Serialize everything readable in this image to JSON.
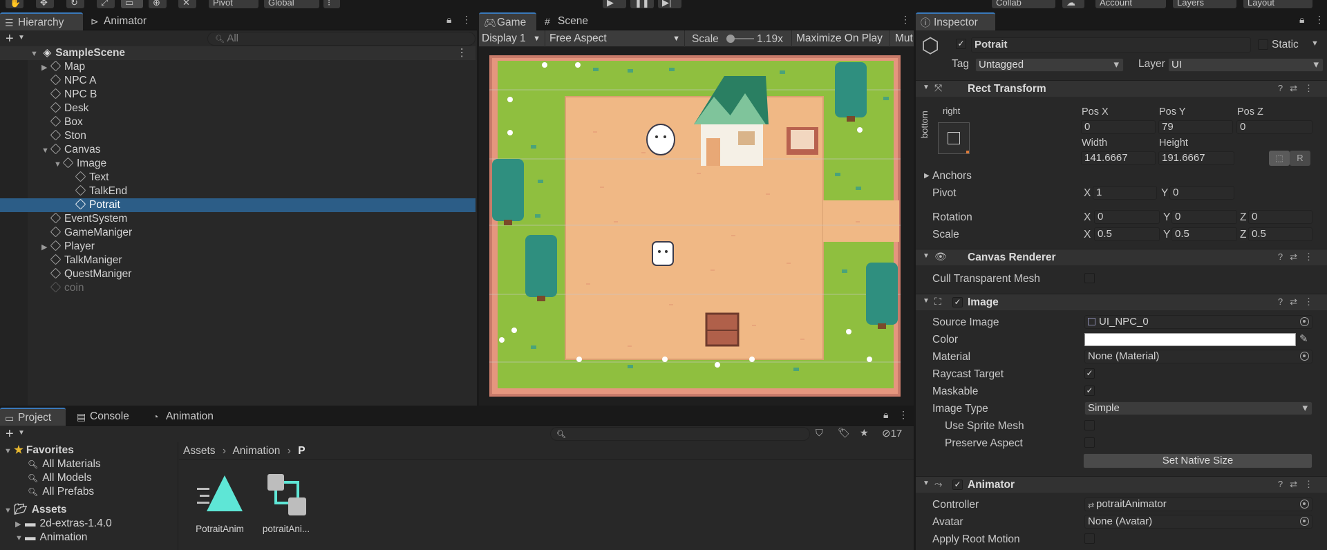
{
  "toolbar": {
    "pivot": "Pivot",
    "global": "Global",
    "collab": "Collab",
    "account": "Account",
    "layers": "Layers",
    "layout": "Layout"
  },
  "hierarchy": {
    "tabs": [
      "Hierarchy",
      "Animator"
    ],
    "search_placeholder": "All",
    "scene": "SampleScene",
    "items": [
      {
        "label": "Map"
      },
      {
        "label": "NPC A"
      },
      {
        "label": "NPC B"
      },
      {
        "label": "Desk"
      },
      {
        "label": "Box"
      },
      {
        "label": "Ston"
      },
      {
        "label": "Canvas"
      },
      {
        "label": "Image"
      },
      {
        "label": "Text"
      },
      {
        "label": "TalkEnd"
      },
      {
        "label": "Potrait"
      },
      {
        "label": "EventSystem"
      },
      {
        "label": "GameManiger"
      },
      {
        "label": "Player"
      },
      {
        "label": "TalkManiger"
      },
      {
        "label": "QuestManiger"
      },
      {
        "label": "coin"
      }
    ]
  },
  "game": {
    "tabs": [
      "Game",
      "Scene"
    ],
    "display": "Display 1",
    "aspect": "Free Aspect",
    "scale_label": "Scale",
    "scale_value": "1.19x",
    "maximize": "Maximize On Play",
    "mute": "Mut"
  },
  "inspector": {
    "tab": "Inspector",
    "object_name": "Potrait",
    "static_label": "Static",
    "tag_label": "Tag",
    "tag_value": "Untagged",
    "layer_label": "Layer",
    "layer_value": "UI",
    "rect": {
      "title": "Rect Transform",
      "anchor_h": "right",
      "anchor_v": "bottom",
      "posx_label": "Pos X",
      "posy_label": "Pos Y",
      "posz_label": "Pos Z",
      "posx": "0",
      "posy": "79",
      "posz": "0",
      "width_label": "Width",
      "height_label": "Height",
      "width": "141.6667",
      "height": "191.6667",
      "r_btn": "R",
      "anchors": "Anchors",
      "pivot": "Pivot",
      "pivot_x": "1",
      "pivot_y": "0",
      "rotation": "Rotation",
      "rot_x": "0",
      "rot_y": "0",
      "rot_z": "0",
      "scale": "Scale",
      "scale_x": "0.5",
      "scale_y": "0.5",
      "scale_z": "0.5",
      "x": "X",
      "y": "Y",
      "z": "Z"
    },
    "canvas_renderer": {
      "title": "Canvas Renderer",
      "cull": "Cull Transparent Mesh"
    },
    "image": {
      "title": "Image",
      "source_label": "Source Image",
      "source_value": "UI_NPC_0",
      "color_label": "Color",
      "material_label": "Material",
      "material_value": "None (Material)",
      "raycast_label": "Raycast Target",
      "maskable_label": "Maskable",
      "type_label": "Image Type",
      "type_value": "Simple",
      "use_sprite_mesh": "Use Sprite Mesh",
      "preserve_aspect": "Preserve Aspect",
      "native_btn": "Set Native Size"
    },
    "animator": {
      "title": "Animator",
      "controller_label": "Controller",
      "controller_value": "potraitAnimator",
      "avatar_label": "Avatar",
      "avatar_value": "None (Avatar)",
      "root_motion": "Apply Root Motion"
    }
  },
  "project": {
    "tabs": [
      "Project",
      "Console",
      "Animation"
    ],
    "count": "17",
    "favorites": "Favorites",
    "fav_items": [
      "All Materials",
      "All Models",
      "All Prefabs"
    ],
    "assets": "Assets",
    "asset_items": [
      "2d-extras-1.4.0",
      "Animation"
    ],
    "breadcrumb": [
      "Assets",
      "Animation",
      "P"
    ],
    "files": [
      {
        "label": "PotraitAnim"
      },
      {
        "label": "potraitAni..."
      }
    ]
  },
  "colors": {
    "accent": "#2c5d87",
    "tab_accent": "#3a79bb",
    "teal": "#5ee6d6",
    "panel": "#282828",
    "grass": "#8fbf3f",
    "dirt": "#f0b885"
  }
}
